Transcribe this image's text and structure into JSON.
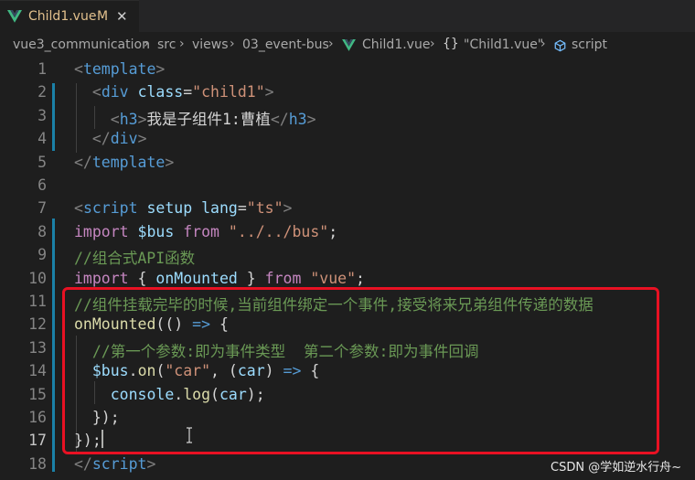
{
  "tab": {
    "title": "Child1.vue",
    "modified": "M",
    "close_glyph": "✕",
    "icon": "vue-logo-icon"
  },
  "breadcrumb": {
    "items": [
      "vue3_communication",
      "src",
      "views",
      "03_event-bus",
      "Child1.vue",
      "\"Child1.vue\"",
      "script"
    ],
    "separator": "›",
    "braces": "{}"
  },
  "editor": {
    "active_line": 17,
    "lines": [
      {
        "n": "1",
        "tokens": [
          [
            "tagb",
            "<"
          ],
          [
            "tag",
            "template"
          ],
          [
            "tagb",
            ">"
          ]
        ]
      },
      {
        "n": "2",
        "tokens": [
          [
            "txt",
            "  "
          ],
          [
            "tagb",
            "<"
          ],
          [
            "tag",
            "div"
          ],
          [
            "txt",
            " "
          ],
          [
            "attr",
            "class"
          ],
          [
            "punc",
            "="
          ],
          [
            "str",
            "\"child1\""
          ],
          [
            "tagb",
            ">"
          ]
        ]
      },
      {
        "n": "3",
        "tokens": [
          [
            "txt",
            "    "
          ],
          [
            "tagb",
            "<"
          ],
          [
            "tag",
            "h3"
          ],
          [
            "tagb",
            ">"
          ],
          [
            "txt",
            "我是子组件1:曹植"
          ],
          [
            "tagb",
            "</"
          ],
          [
            "tag",
            "h3"
          ],
          [
            "tagb",
            ">"
          ]
        ]
      },
      {
        "n": "4",
        "tokens": [
          [
            "txt",
            "  "
          ],
          [
            "tagb",
            "</"
          ],
          [
            "tag",
            "div"
          ],
          [
            "tagb",
            ">"
          ]
        ]
      },
      {
        "n": "5",
        "tokens": [
          [
            "tagb",
            "</"
          ],
          [
            "tag",
            "template"
          ],
          [
            "tagb",
            ">"
          ]
        ]
      },
      {
        "n": "6",
        "tokens": []
      },
      {
        "n": "7",
        "tokens": [
          [
            "tagb",
            "<"
          ],
          [
            "tag",
            "script"
          ],
          [
            "txt",
            " "
          ],
          [
            "attr",
            "setup"
          ],
          [
            "txt",
            " "
          ],
          [
            "attr",
            "lang"
          ],
          [
            "punc",
            "="
          ],
          [
            "str",
            "\"ts\""
          ],
          [
            "tagb",
            ">"
          ]
        ]
      },
      {
        "n": "8",
        "tokens": [
          [
            "kw",
            "import"
          ],
          [
            "txt",
            " "
          ],
          [
            "var",
            "$bus"
          ],
          [
            "txt",
            " "
          ],
          [
            "kw",
            "from"
          ],
          [
            "txt",
            " "
          ],
          [
            "str",
            "\"../../bus\""
          ],
          [
            "punc",
            ";"
          ]
        ]
      },
      {
        "n": "9",
        "tokens": [
          [
            "com",
            "//组合式API函数"
          ]
        ]
      },
      {
        "n": "10",
        "tokens": [
          [
            "kw",
            "import"
          ],
          [
            "txt",
            " { "
          ],
          [
            "var",
            "onMounted"
          ],
          [
            "txt",
            " } "
          ],
          [
            "kw",
            "from"
          ],
          [
            "txt",
            " "
          ],
          [
            "str",
            "\"vue\""
          ],
          [
            "punc",
            ";"
          ]
        ]
      },
      {
        "n": "11",
        "tokens": [
          [
            "com",
            "//组件挂载完毕的时候,当前组件绑定一个事件,接受将来兄弟组件传递的数据"
          ]
        ]
      },
      {
        "n": "12",
        "tokens": [
          [
            "fn",
            "onMounted"
          ],
          [
            "punc",
            "(() "
          ],
          [
            "arrow",
            "=>"
          ],
          [
            "punc",
            " {"
          ]
        ]
      },
      {
        "n": "13",
        "tokens": [
          [
            "txt",
            "  "
          ],
          [
            "com",
            "//第一个参数:即为事件类型  第二个参数:即为事件回调"
          ]
        ]
      },
      {
        "n": "14",
        "tokens": [
          [
            "txt",
            "  "
          ],
          [
            "var",
            "$bus"
          ],
          [
            "punc",
            "."
          ],
          [
            "fn",
            "on"
          ],
          [
            "punc",
            "("
          ],
          [
            "str",
            "\"car\""
          ],
          [
            "punc",
            ", ("
          ],
          [
            "var",
            "car"
          ],
          [
            "punc",
            ") "
          ],
          [
            "arrow",
            "=>"
          ],
          [
            "punc",
            " {"
          ]
        ]
      },
      {
        "n": "15",
        "tokens": [
          [
            "txt",
            "    "
          ],
          [
            "var",
            "console"
          ],
          [
            "punc",
            "."
          ],
          [
            "fn",
            "log"
          ],
          [
            "punc",
            "("
          ],
          [
            "var",
            "car"
          ],
          [
            "punc",
            ");"
          ]
        ]
      },
      {
        "n": "16",
        "tokens": [
          [
            "txt",
            "  "
          ],
          [
            "punc",
            "});"
          ]
        ]
      },
      {
        "n": "17",
        "tokens": [
          [
            "punc",
            "});"
          ]
        ]
      },
      {
        "n": "18",
        "tokens": [
          [
            "tagb",
            "</"
          ],
          [
            "tag",
            "script"
          ],
          [
            "tagb",
            ">"
          ]
        ]
      }
    ]
  },
  "watermark": "CSDN @学如逆水行舟~",
  "colors": {
    "editor_bg": "#1e1e1e",
    "highlight_box": "#e81123",
    "modified_bar": "#1b81a8",
    "vue_green": "#41b883",
    "tab_modified_text": "#e2c08d"
  }
}
